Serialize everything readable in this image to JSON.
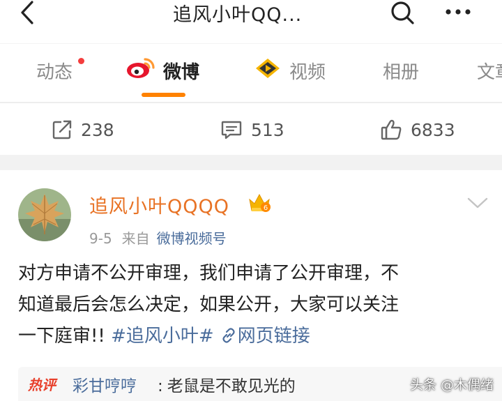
{
  "header": {
    "title": "追风小叶QQ...",
    "back_icon": "chevron-left-icon",
    "search_icon": "search-icon",
    "more_icon": "more-horizontal-icon"
  },
  "tabs": [
    {
      "label": "动态",
      "has_dot": true
    },
    {
      "label": "微博",
      "active": true,
      "icon": "weibo-logo-icon"
    },
    {
      "label": "视频",
      "icon": "video-icon"
    },
    {
      "label": "相册"
    },
    {
      "label": "文章"
    }
  ],
  "colors": {
    "accent": "#ff8200",
    "username": "#e87224",
    "link": "#4a6c9b",
    "dot": "#f43d3d"
  },
  "stats": {
    "reposts": "238",
    "comments": "513",
    "likes": "6833"
  },
  "post": {
    "author": "追风小叶QQQQ",
    "date": "9-5",
    "source_prefix": "来自",
    "source": "微博视频号",
    "text_line1": "对方申请不公开审理，我们申请了公开审理，不",
    "text_line2": "知道最后会怎么决定，如果公开，大家可以关注",
    "text_line3": "一下庭审!! ",
    "hashtag": "#追风小叶#",
    "link_text": "网页链接"
  },
  "hot_comment": {
    "badge": "热评",
    "user": "彩甘哼哼",
    "colon": ":",
    "text": "老鼠是不敢见光的"
  },
  "watermark": "头条 @木偶绪"
}
